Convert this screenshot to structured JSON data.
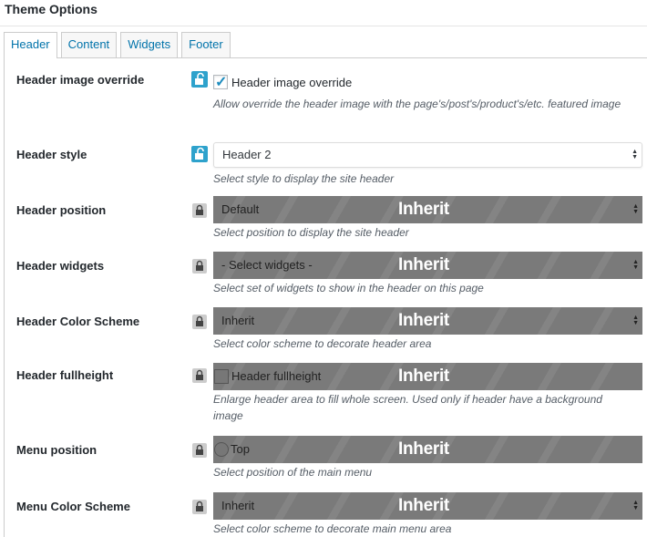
{
  "title": "Theme Options",
  "tabs": [
    {
      "label": "Header",
      "active": true
    },
    {
      "label": "Content",
      "active": false
    },
    {
      "label": "Widgets",
      "active": false
    },
    {
      "label": "Footer",
      "active": false
    }
  ],
  "inherit_label": "Inherit",
  "rows": {
    "header_image_override": {
      "label": "Header image override",
      "checkbox_label": "Header image override",
      "checked": true,
      "description": "Allow override the header image with the page's/post's/product's/etc. featured image",
      "lock": "unlocked"
    },
    "header_style": {
      "label": "Header style",
      "value": "Header 2",
      "description": "Select style to display the site header",
      "lock": "unlocked"
    },
    "header_position": {
      "label": "Header position",
      "value": "Default",
      "description": "Select position to display the site header",
      "lock": "locked"
    },
    "header_widgets": {
      "label": "Header widgets",
      "value": "- Select widgets -",
      "description": "Select set of widgets to show in the header on this page",
      "lock": "locked"
    },
    "header_color_scheme": {
      "label": "Header Color Scheme",
      "value": "Inherit",
      "description": "Select color scheme to decorate header area",
      "lock": "locked"
    },
    "header_fullheight": {
      "label": "Header fullheight",
      "checkbox_label": "Header fullheight",
      "description": "Enlarge header area to fill whole screen. Used only if header have a background image",
      "lock": "locked"
    },
    "menu_position": {
      "label": "Menu position",
      "radio_label": "Top",
      "description": "Select position of the main menu",
      "lock": "locked"
    },
    "menu_color_scheme": {
      "label": "Menu Color Scheme",
      "value": "Inherit",
      "description": "Select color scheme to decorate main menu area",
      "lock": "locked"
    }
  },
  "colors": {
    "accent": "#0073aa",
    "lock_open": "#2ea2cc",
    "inherit_bar": "#7a7a7a"
  }
}
